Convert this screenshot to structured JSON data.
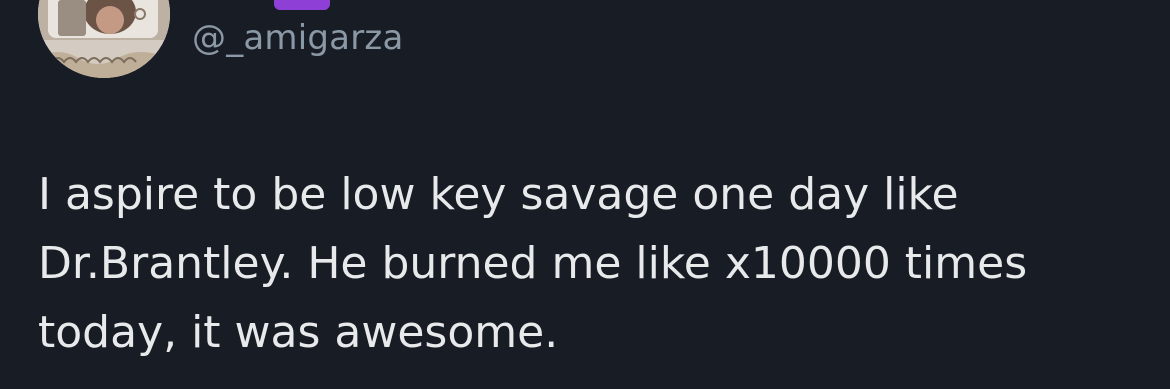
{
  "tweet": {
    "handle": "@_amigarza",
    "text": "I aspire to be low key savage one day like\nDr.Brantley. He burned me like x10000 times\ntoday, it was awesome."
  },
  "colors": {
    "background": "#181c25",
    "text": "#e7e9ea",
    "handle": "#8b98a5",
    "badge": "#8e3fd6"
  },
  "icons": {
    "avatar": "profile-photo",
    "badge": "purple-badge"
  }
}
